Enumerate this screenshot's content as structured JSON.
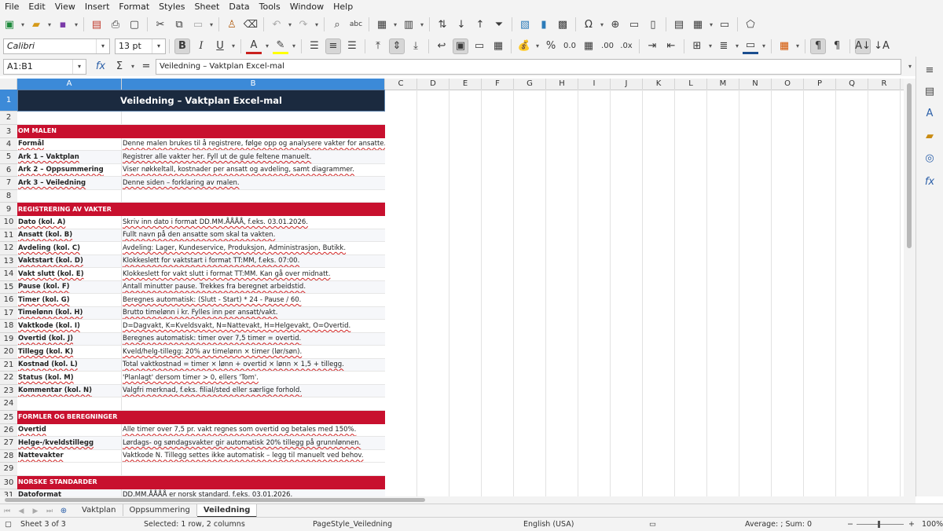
{
  "menu": [
    "File",
    "Edit",
    "View",
    "Insert",
    "Format",
    "Styles",
    "Sheet",
    "Data",
    "Tools",
    "Window",
    "Help"
  ],
  "font_name": "Calibri",
  "font_size": "13 pt",
  "name_box": "A1:B1",
  "formula_content": "Veiledning – Vaktplan Excel-mal",
  "columns": [
    "A",
    "B",
    "C",
    "D",
    "E",
    "F",
    "G",
    "H",
    "I",
    "J",
    "K",
    "L",
    "M",
    "N",
    "O",
    "P",
    "Q",
    "R"
  ],
  "rows": [
    {
      "n": "1",
      "type": "title",
      "b": "Veiledning – Vaktplan Excel-mal"
    },
    {
      "n": "2",
      "type": "blank"
    },
    {
      "n": "3",
      "type": "section",
      "a": "OM MALEN"
    },
    {
      "n": "4",
      "type": "data",
      "a": "Formål",
      "b": "Denne malen brukes til å registrere, følge opp og analysere vakter for ansatte."
    },
    {
      "n": "5",
      "type": "data",
      "a": "Ark 1 – Vaktplan",
      "b": "Registrer alle vakter her. Fyll ut de gule feltene manuelt."
    },
    {
      "n": "6",
      "type": "data",
      "a": "Ark 2 – Oppsummering",
      "b": "Viser nøkkeltall, kostnader per ansatt og avdeling, samt diagrammer."
    },
    {
      "n": "7",
      "type": "data",
      "a": "Ark 3 – Veiledning",
      "b": "Denne siden – forklaring av malen."
    },
    {
      "n": "8",
      "type": "blank"
    },
    {
      "n": "9",
      "type": "section",
      "a": "REGISTRERING AV VAKTER"
    },
    {
      "n": "10",
      "type": "data",
      "a": "Dato (kol. A)",
      "b": "Skriv inn dato i format DD.MM.ÅÅÅÅ, f.eks. 03.01.2026."
    },
    {
      "n": "11",
      "type": "data",
      "a": "Ansatt (kol. B)",
      "b": "Fullt navn på den ansatte som skal ta vakten."
    },
    {
      "n": "12",
      "type": "data",
      "a": "Avdeling (kol. C)",
      "b": "Avdeling: Lager, Kundeservice, Produksjon, Administrasjon, Butikk."
    },
    {
      "n": "13",
      "type": "data",
      "a": "Vaktstart (kol. D)",
      "b": "Klokkeslett for vaktstart i format TT:MM, f.eks. 07:00."
    },
    {
      "n": "14",
      "type": "data",
      "a": "Vakt slutt (kol. E)",
      "b": "Klokkeslett for vakt slutt i format TT:MM. Kan gå over midnatt."
    },
    {
      "n": "15",
      "type": "data",
      "a": "Pause (kol. F)",
      "b": "Antall minutter pause. Trekkes fra beregnet arbeidstid."
    },
    {
      "n": "16",
      "type": "data",
      "a": "Timer (kol. G)",
      "b": "Beregnes automatisk: (Slutt - Start) * 24 - Pause / 60."
    },
    {
      "n": "17",
      "type": "data",
      "a": "Timelønn (kol. H)",
      "b": "Brutto timelønn i kr. Fylles inn per ansatt/vakt."
    },
    {
      "n": "18",
      "type": "data",
      "a": "Vaktkode (kol. I)",
      "b": "D=Dagvakt, K=Kveldsvakt, N=Nattevakt, H=Helgevakt, O=Overtid."
    },
    {
      "n": "19",
      "type": "data",
      "a": "Overtid (kol. J)",
      "b": "Beregnes automatisk: timer over 7,5 timer = overtid."
    },
    {
      "n": "20",
      "type": "data",
      "a": "Tillegg (kol. K)",
      "b": "Kveld/helg-tillegg: 20% av timelønn × timer (lør/søn)."
    },
    {
      "n": "21",
      "type": "data",
      "a": "Kostnad (kol. L)",
      "b": "Total vaktkostnad = timer × lønn + overtid × lønn × 1,5 + tillegg."
    },
    {
      "n": "22",
      "type": "data",
      "a": "Status (kol. M)",
      "b": "'Planlagt' dersom timer > 0, ellers 'Tom'."
    },
    {
      "n": "23",
      "type": "data",
      "a": "Kommentar (kol. N)",
      "b": "Valgfri merknad, f.eks. filial/sted eller særlige forhold."
    },
    {
      "n": "24",
      "type": "blank"
    },
    {
      "n": "25",
      "type": "section",
      "a": "FORMLER OG BEREGNINGER"
    },
    {
      "n": "26",
      "type": "data",
      "a": "Overtid",
      "b": "Alle timer over 7,5 pr. vakt regnes som overtid og betales med 150%."
    },
    {
      "n": "27",
      "type": "data",
      "a": "Helge-/kveldstillegg",
      "b": "Lørdags- og søndagsvakter gir automatisk 20% tillegg på grunnlønnen."
    },
    {
      "n": "28",
      "type": "data",
      "a": "Nattevakter",
      "b": "Vaktkode N. Tillegg settes ikke automatisk – legg til manuelt ved behov."
    },
    {
      "n": "29",
      "type": "blank"
    },
    {
      "n": "30",
      "type": "section",
      "a": "NORSKE STANDARDER"
    },
    {
      "n": "31",
      "type": "data",
      "a": "Datoformat",
      "b": "DD.MM.ÅÅÅÅ er norsk standard, f.eks. 03.01.2026."
    }
  ],
  "tabs": [
    "Vaktplan",
    "Oppsummering",
    "Veiledning"
  ],
  "active_tab": "Veiledning",
  "status": {
    "sheet": "Sheet 3 of 3",
    "selection": "Selected: 1 row, 2 columns",
    "page_style": "PageStyle_Veiledning",
    "language": "English (USA)",
    "summary": "Average: ; Sum: 0",
    "zoom": "100%"
  },
  "colors": {
    "title_bg": "#1b2a3f",
    "section_bg": "#c8102e",
    "selection": "#3c8ad8"
  }
}
